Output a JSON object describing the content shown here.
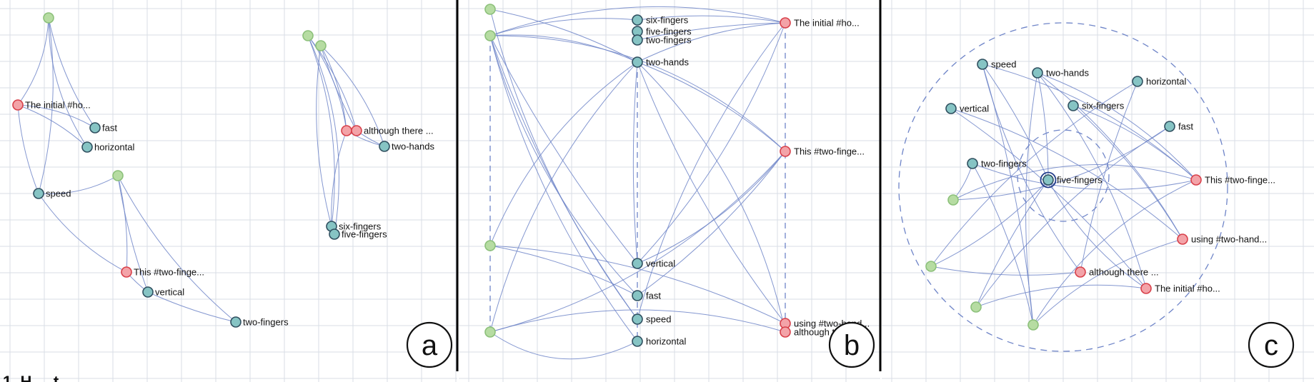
{
  "panels": [
    {
      "id": "a",
      "label": "a",
      "nodes": [
        {
          "id": "g1",
          "type": "green",
          "label": ""
        },
        {
          "id": "r1",
          "type": "red",
          "label": "The initial #ho..."
        },
        {
          "id": "fast",
          "type": "teal",
          "label": "fast"
        },
        {
          "id": "hor",
          "type": "teal",
          "label": "horizontal"
        },
        {
          "id": "speed",
          "type": "teal",
          "label": "speed"
        },
        {
          "id": "g2",
          "type": "green",
          "label": ""
        },
        {
          "id": "r2",
          "type": "red",
          "label": "This #two-finge..."
        },
        {
          "id": "vert",
          "type": "teal",
          "label": "vertical"
        },
        {
          "id": "twof",
          "type": "teal",
          "label": "two-fingers"
        },
        {
          "id": "g3",
          "type": "green",
          "label": ""
        },
        {
          "id": "g4",
          "type": "green",
          "label": ""
        },
        {
          "id": "r3",
          "type": "red",
          "label": ""
        },
        {
          "id": "r4",
          "type": "red",
          "label": "although there ..."
        },
        {
          "id": "twoh",
          "type": "teal",
          "label": "two-hands"
        },
        {
          "id": "six",
          "type": "teal",
          "label": "six-fingers"
        },
        {
          "id": "five",
          "type": "teal",
          "label": "five-fingers"
        }
      ]
    },
    {
      "id": "b",
      "label": "b",
      "nodes": [
        {
          "id": "g1",
          "type": "green",
          "label": ""
        },
        {
          "id": "g2",
          "type": "green",
          "label": ""
        },
        {
          "id": "g3",
          "type": "green",
          "label": ""
        },
        {
          "id": "g4",
          "type": "green",
          "label": ""
        },
        {
          "id": "six",
          "type": "teal",
          "label": "six-fingers"
        },
        {
          "id": "five",
          "type": "teal",
          "label": "five-fingers"
        },
        {
          "id": "twof",
          "type": "teal",
          "label": "two-fingers"
        },
        {
          "id": "twoh",
          "type": "teal",
          "label": "two-hands"
        },
        {
          "id": "vert",
          "type": "teal",
          "label": "vertical"
        },
        {
          "id": "fast",
          "type": "teal",
          "label": "fast"
        },
        {
          "id": "speed",
          "type": "teal",
          "label": "speed"
        },
        {
          "id": "hor",
          "type": "teal",
          "label": "horizontal"
        },
        {
          "id": "r1",
          "type": "red",
          "label": "The initial #ho..."
        },
        {
          "id": "r2",
          "type": "red",
          "label": "This #two-finge..."
        },
        {
          "id": "r3",
          "type": "red",
          "label": "using #two-hand..."
        },
        {
          "id": "r4",
          "type": "red",
          "label": "although t..."
        }
      ]
    },
    {
      "id": "c",
      "label": "c",
      "nodes": [
        {
          "id": "speed",
          "type": "teal",
          "label": "speed"
        },
        {
          "id": "twoh",
          "type": "teal",
          "label": "two-hands"
        },
        {
          "id": "hor",
          "type": "teal",
          "label": "horizontal"
        },
        {
          "id": "vert",
          "type": "teal",
          "label": "vertical"
        },
        {
          "id": "six",
          "type": "teal",
          "label": "six-fingers"
        },
        {
          "id": "fast",
          "type": "teal",
          "label": "fast"
        },
        {
          "id": "twof",
          "type": "teal",
          "label": "two-fingers"
        },
        {
          "id": "five",
          "type": "teal",
          "label": "five-fingers"
        },
        {
          "id": "r1",
          "type": "red",
          "label": "This #two-finge..."
        },
        {
          "id": "r2",
          "type": "red",
          "label": "using #two-hand..."
        },
        {
          "id": "r3",
          "type": "red",
          "label": "although there ..."
        },
        {
          "id": "r4",
          "type": "red",
          "label": "The initial #ho..."
        },
        {
          "id": "g1",
          "type": "green",
          "label": ""
        },
        {
          "id": "g2",
          "type": "green",
          "label": ""
        },
        {
          "id": "g3",
          "type": "green",
          "label": ""
        },
        {
          "id": "g4",
          "type": "green",
          "label": ""
        }
      ]
    }
  ],
  "colors": {
    "grid": "#d9dde6",
    "edge": "#6f85c8",
    "dash": "#6f85c8",
    "green_fill": "#b6dca2",
    "green_stroke": "#8cc07a",
    "red_fill": "#f3a3a8",
    "red_stroke": "#d8404a",
    "teal_fill": "#86c4c4",
    "teal_stroke": "#2f4f5f",
    "divider": "#000000"
  },
  "caption_fragment": "1. H ... t ...",
  "icons": [
    "circle-label-icon"
  ]
}
